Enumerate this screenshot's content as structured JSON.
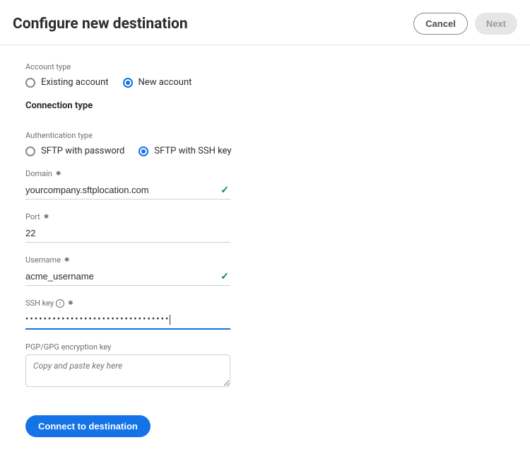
{
  "page": {
    "title": "Configure new destination"
  },
  "header": {
    "cancel": "Cancel",
    "next": "Next"
  },
  "account_type": {
    "label": "Account type",
    "existing": "Existing account",
    "new": "New account"
  },
  "connection_type": {
    "label": "Connection type"
  },
  "auth_type": {
    "label": "Authentication type",
    "password": "SFTP with password",
    "sshkey": "SFTP with SSH key"
  },
  "domain": {
    "label": "Domain",
    "value": "yourcompany.sftplocation.com"
  },
  "port": {
    "label": "Port",
    "value": "22"
  },
  "username": {
    "label": "Username",
    "value": "acme_username"
  },
  "sshkey": {
    "label": "SSH key",
    "value": "••••••••••••••••••••••••••••••••"
  },
  "pgp": {
    "label": "PGP/GPG encryption key",
    "placeholder": "Copy and paste key here"
  },
  "buttons": {
    "connect": "Connect to destination"
  }
}
